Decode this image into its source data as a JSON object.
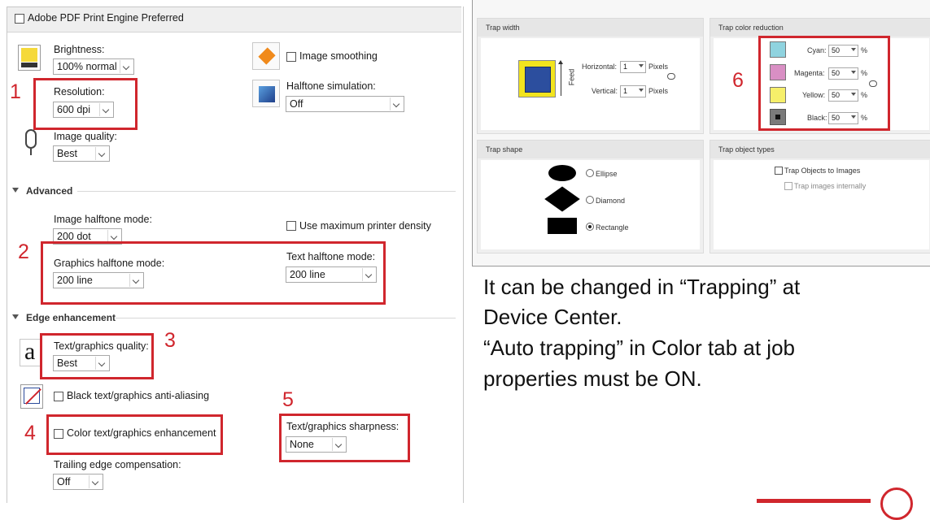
{
  "left_panel": {
    "header_label": "Adobe PDF Print Engine Preferred",
    "brightness": {
      "label": "Brightness:",
      "value": "100% normal"
    },
    "resolution": {
      "label": "Resolution:",
      "value": "600 dpi"
    },
    "image_quality": {
      "label": "Image quality:",
      "value": "Best"
    },
    "image_smoothing": {
      "label": "Image smoothing"
    },
    "halftone_simulation": {
      "label": "Halftone simulation:",
      "value": "Off"
    },
    "advanced": {
      "title": "Advanced",
      "image_halftone_mode": {
        "label": "Image halftone mode:",
        "value": "200 dot"
      },
      "max_density": {
        "label": "Use maximum printer density"
      },
      "graphics_halftone_mode": {
        "label": "Graphics halftone mode:",
        "value": "200 line"
      },
      "text_halftone_mode": {
        "label": "Text halftone mode:",
        "value": "200 line"
      }
    },
    "edge": {
      "title": "Edge enhancement",
      "text_graphics_quality": {
        "label": "Text/graphics quality:",
        "value": "Best"
      },
      "anti_aliasing": {
        "label": "Black text/graphics anti-aliasing"
      },
      "color_enhancement": {
        "label": "Color text/graphics enhancement"
      },
      "sharpness": {
        "label": "Text/graphics sharpness:",
        "value": "None"
      },
      "trailing_edge": {
        "label": "Trailing edge compensation:",
        "value": "Off"
      }
    },
    "callouts": [
      "1",
      "2",
      "3",
      "4",
      "5"
    ],
    "icon_glyph_a": "a"
  },
  "trap_panel": {
    "trap_width": {
      "title": "Trap width",
      "horizontal_label": "Horizontal:",
      "horizontal_value": "1",
      "vertical_label": "Vertical:",
      "vertical_value": "1",
      "unit": "Pixels",
      "feed_label": "Feed"
    },
    "trap_color_reduction": {
      "title": "Trap color reduction",
      "callout": "6",
      "percent": "%",
      "colors": [
        {
          "label": "Cyan:",
          "value": "50",
          "swatch": "#8fd3df"
        },
        {
          "label": "Magenta:",
          "value": "50",
          "swatch": "#d98fc4"
        },
        {
          "label": "Yellow:",
          "value": "50",
          "swatch": "#f6ef6a"
        },
        {
          "label": "Black:",
          "value": "50",
          "swatch": "#7a7a7a"
        }
      ]
    },
    "trap_shape": {
      "title": "Trap shape",
      "options": [
        "Ellipse",
        "Diamond",
        "Rectangle"
      ],
      "selected": "Rectangle"
    },
    "trap_object_types": {
      "title": "Trap object types",
      "trap_objects_to_images": "Trap Objects to Images",
      "trap_images_internally": "Trap images internally"
    }
  },
  "note": {
    "line1": "It can be changed in “Trapping” at",
    "line2": "Device Center.",
    "line3": "“Auto trapping” in Color tab at job",
    "line4": "properties must be ON."
  },
  "accent_color": "#d0262d"
}
